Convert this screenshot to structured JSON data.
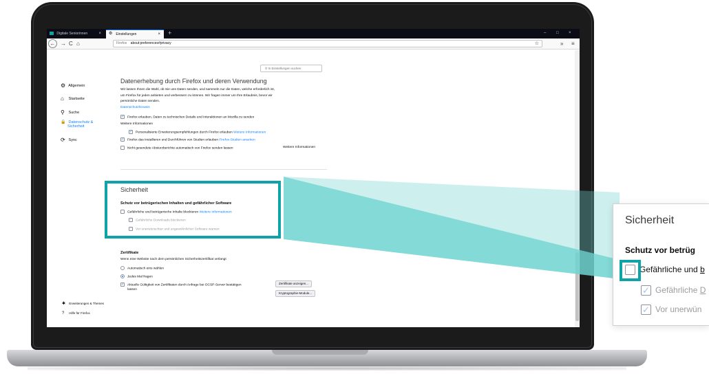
{
  "browser": {
    "tabs": [
      {
        "label": "Digitale Seniorinnen",
        "close": "×"
      },
      {
        "label": "Einstellungen",
        "close": "×"
      }
    ],
    "new_tab": "+",
    "window_controls": [
      "–",
      "□",
      "×"
    ],
    "back": "←",
    "forward": "→",
    "reload": "C",
    "home": "⌂",
    "url_label": "Firefox",
    "url": "about:preferences#privacy",
    "bookmark": "☆",
    "overflow": "»",
    "menu": "≡"
  },
  "search": {
    "placeholder": "In Einstellungen suchen"
  },
  "sidebar": {
    "items": [
      {
        "icon": "⚙",
        "label": "Allgemein"
      },
      {
        "icon": "⌂",
        "label": "Startseite"
      },
      {
        "icon": "⚲",
        "label": "Suche"
      },
      {
        "icon": "🔒",
        "label_line1": "Datenschutz &",
        "label_line2": "Sicherheit"
      },
      {
        "icon": "⟳",
        "label": "Sync"
      }
    ],
    "bottom": [
      {
        "icon": "✱",
        "label": "Erweiterungen & Themes"
      },
      {
        "icon": "?",
        "label": "Hilfe für Firefox"
      }
    ]
  },
  "data_collection": {
    "heading": "Datenerhebung durch Firefox und deren Verwendung",
    "para_line1": "Wir lassen Ihnen die Wahl, ob Sie uns Daten senden, und sammeln nur die Daten, welche erforderlich ist,",
    "para_line2": "um Firefox für jeden anbieten und verbessern zu können. Wir fragen immer um Ihre Erlaubnis, bevor wir",
    "para_line3": "persönliche Daten senden.",
    "privacy_link": "Datenschutzhinweis",
    "opt1": "Firefox erlauben, Daten zu technischen Details und Interaktionen an Mozilla zu senden",
    "more_info": "Weitere Informationen",
    "opt2": "Personalisierte Erweiterungsempfehlungen durch Firefox erlauben",
    "opt2_link": "Weitere Informationen",
    "opt3": "Firefox das Installieren und Durchführen von Studien erlauben",
    "opt3_link": "Firefox-Studien ansehen",
    "opt4": "Nicht gesendete Absturzberichte automatisch von Firefox senden lassen",
    "opt4_link": "Weitere Informationen"
  },
  "security": {
    "heading": "Sicherheit",
    "subheading": "Schutz vor betrügerischen Inhalten und gefährlicher Software",
    "opt_block": "Gefährliche und betrügerische Inhalte blockieren",
    "opt_block_link": "Weitere Informationen",
    "opt_downloads": "Gefährliche Downloads blockieren",
    "opt_warn": "Vor unerwünschter und ungewöhnlicher Software warnen"
  },
  "certificates": {
    "heading": "Zertifikate",
    "desc": "Wenn eine Website nach dem persönlichen Sicherheitszertifikat verlangt",
    "radio_auto": "Automatisch eins wählen",
    "radio_ask": "Jedes Mal fragen",
    "ocsp_line1": "Aktuelle Gültigkeit von Zertifikaten durch Anfrage bei OCSP-Server bestätigen",
    "ocsp_line2": "lassen",
    "btn_show": "Zertifikate anzeigen...",
    "btn_crypto": "Kryptographie-Module..."
  },
  "zoom": {
    "heading": "Sicherheit",
    "subheading": "Schutz vor betrüg",
    "opt_block": "Gefährliche und ",
    "opt_block_u": "b",
    "opt_downloads": "Gefährliche ",
    "opt_downloads_u": "D",
    "opt_warn": "Vor unerwün"
  },
  "check_mark": "✓",
  "colors": {
    "accent": "#0a84ff",
    "highlight": "#0fa3a8",
    "beam": "#6fd3cf"
  }
}
